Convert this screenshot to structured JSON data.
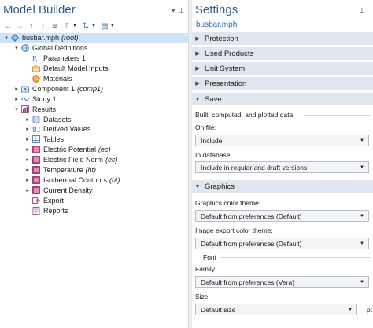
{
  "model_builder": {
    "title": "Model Builder",
    "tree": [
      {
        "label": "busbar.mph",
        "suffix": "(root)",
        "toggle": "▾",
        "icon": "root-icon",
        "level": 0,
        "selected": true
      },
      {
        "label": "Global Definitions",
        "suffix": "",
        "toggle": "▾",
        "icon": "globe-icon",
        "level": 1
      },
      {
        "label": "Parameters 1",
        "suffix": "",
        "toggle": "",
        "icon": "parameters-icon",
        "level": 2
      },
      {
        "label": "Default Model Inputs",
        "suffix": "",
        "toggle": "",
        "icon": "model-inputs-icon",
        "level": 2
      },
      {
        "label": "Materials",
        "suffix": "",
        "toggle": "",
        "icon": "materials-icon",
        "level": 2
      },
      {
        "label": "Component 1",
        "suffix": "(comp1)",
        "toggle": "▸",
        "icon": "component-icon",
        "level": 1
      },
      {
        "label": "Study 1",
        "suffix": "",
        "toggle": "▸",
        "icon": "study-icon",
        "level": 1
      },
      {
        "label": "Results",
        "suffix": "",
        "toggle": "▾",
        "icon": "results-icon",
        "level": 1
      },
      {
        "label": "Datasets",
        "suffix": "",
        "toggle": "▸",
        "icon": "datasets-icon",
        "level": 2
      },
      {
        "label": "Derived Values",
        "suffix": "",
        "toggle": "▸",
        "icon": "derived-values-icon",
        "level": 2
      },
      {
        "label": "Tables",
        "suffix": "",
        "toggle": "▸",
        "icon": "tables-icon",
        "level": 2
      },
      {
        "label": "Electric Potential",
        "suffix": "(ec)",
        "toggle": "▸",
        "icon": "plot-group-icon",
        "level": 2
      },
      {
        "label": "Electric Field Norm",
        "suffix": "(ec)",
        "toggle": "▸",
        "icon": "plot-group-icon",
        "level": 2
      },
      {
        "label": "Temperature",
        "suffix": "(ht)",
        "toggle": "▸",
        "icon": "plot-group-icon",
        "level": 2
      },
      {
        "label": "Isothermal Contours",
        "suffix": "(ht)",
        "toggle": "▸",
        "icon": "plot-group-icon",
        "level": 2
      },
      {
        "label": "Current Density",
        "suffix": "",
        "toggle": "▸",
        "icon": "plot-group-icon",
        "level": 2
      },
      {
        "label": "Export",
        "suffix": "",
        "toggle": "",
        "icon": "export-icon",
        "level": 2
      },
      {
        "label": "Reports",
        "suffix": "",
        "toggle": "",
        "icon": "reports-icon",
        "level": 2
      }
    ]
  },
  "settings": {
    "title": "Settings",
    "subtitle": "busbar.mph",
    "sections": {
      "protection": "Protection",
      "used_products": "Used Products",
      "unit_system": "Unit System",
      "presentation": "Presentation",
      "save": "Save",
      "graphics": "Graphics"
    },
    "save": {
      "subhead": "Built, computed, and plotted data",
      "on_file_label": "On file:",
      "on_file_value": "Include",
      "in_database_label": "In database:",
      "in_database_value": "Include in regular and draft versions"
    },
    "graphics": {
      "color_theme_label": "Graphics color theme:",
      "color_theme_value": "Default from preferences (Default)",
      "export_theme_label": "Image export color theme:",
      "export_theme_value": "Default from preferences (Default)",
      "font_subhead": "Font",
      "family_label": "Family:",
      "family_value": "Default from preferences (Vera)",
      "size_label": "Size:",
      "size_value": "Default size",
      "size_unit": "pt"
    }
  },
  "colors": {
    "title": "#2f5d8a",
    "section_bg": "#dfe6ee",
    "selected_bg": "#cfe3f8",
    "plot_icon": "#a03a7a"
  }
}
